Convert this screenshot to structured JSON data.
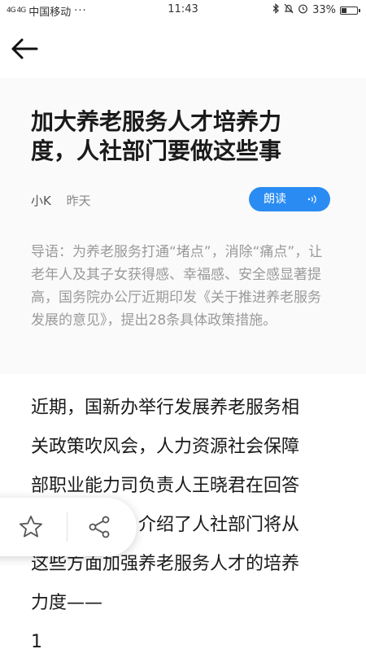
{
  "status_bar": {
    "signal": "4G 4G",
    "carrier": "中国移动",
    "dots": "···",
    "time": "11:43",
    "battery": "33%",
    "battery_level": 0.33
  },
  "article": {
    "title_line1": "加大养老服务人才培养力",
    "title_line2": "度，人社部门要做这些事",
    "author": "小K",
    "date": "昨天",
    "read_button": "朗读",
    "summary": "导语：为养老服务打通“堵点”，消除“痛点”，让老年人及其子女获得感、幸福感、安全感显著提高，国务院办公厅近期印发《关于推进养老服务发展的意见》，提出28条具体政策措施。",
    "body_lines": [
      "近期，国新办举行发展养老服务相",
      "关政策吹风会，人力资源社会保障",
      "部职业能力司负责人王晓君在回答",
      "记者提问时，介绍了人社部门将从",
      "这些方面加强养老服务人才的培养",
      "力度——",
      "1"
    ]
  },
  "icons": {
    "back": "arrow-left-icon",
    "read": "sound-wave-icon",
    "favorite": "star-icon",
    "share": "share-icon"
  }
}
